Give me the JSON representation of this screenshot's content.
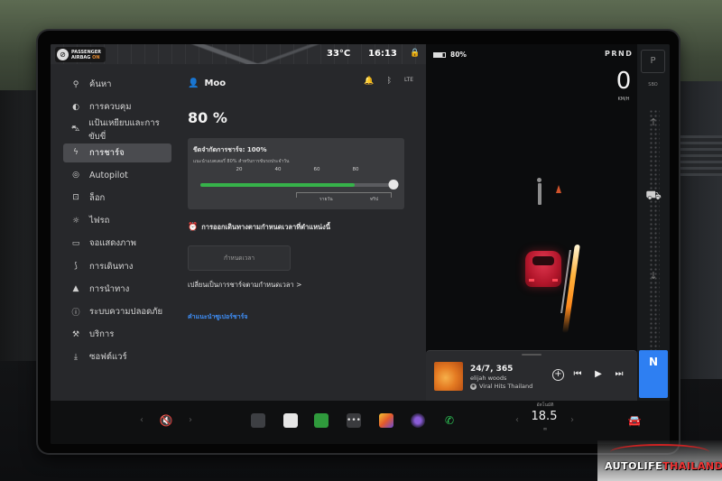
{
  "status_bar": {
    "airbag_line1": "PASSENGER",
    "airbag_line2": "AIRBAG",
    "airbag_state": "ON",
    "temperature": "33°C",
    "time": "16:13"
  },
  "sidebar": {
    "items": [
      {
        "label": "ค้นหา",
        "icon": "search-icon",
        "glyph": "⚲"
      },
      {
        "label": "การควบคุม",
        "icon": "toggle-icon",
        "glyph": "◐"
      },
      {
        "label": "แป้นเหยียบและการขับขี่",
        "icon": "car-icon",
        "glyph": "⛍"
      },
      {
        "label": "การชาร์จ",
        "icon": "lightning-icon",
        "glyph": "ϟ",
        "active": true
      },
      {
        "label": "Autopilot",
        "icon": "steering-wheel-icon",
        "glyph": "◎"
      },
      {
        "label": "ล็อก",
        "icon": "lock-icon",
        "glyph": "⊡"
      },
      {
        "label": "ไฟรถ",
        "icon": "light-icon",
        "glyph": "☼"
      },
      {
        "label": "จอแสดงภาพ",
        "icon": "display-icon",
        "glyph": "▭"
      },
      {
        "label": "การเดินทาง",
        "icon": "trips-icon",
        "glyph": "⟆"
      },
      {
        "label": "การนำทาง",
        "icon": "navigation-icon",
        "glyph": "▲"
      },
      {
        "label": "ระบบความปลอดภัย",
        "icon": "safety-icon",
        "glyph": "ⓘ"
      },
      {
        "label": "บริการ",
        "icon": "wrench-icon",
        "glyph": "⚒"
      },
      {
        "label": "ซอฟต์แวร์",
        "icon": "download-icon",
        "glyph": "⤓"
      }
    ]
  },
  "profile": {
    "name": "Moo",
    "network": "LTE"
  },
  "charging": {
    "state_of_charge": "80 %",
    "limit_title": "ขีดจำกัดการชาร์จ: 100%",
    "limit_sub": "แนะนำแบตเตอรี่ 80% สำหรับการขับรถประจำวัน",
    "ticks": [
      "20",
      "40",
      "60",
      "80"
    ],
    "slider_value": 100,
    "battery_fill": 80,
    "label_daily": "รายวัน",
    "label_trip": "ทริป",
    "departure_label": "การออกเดินทางตามกำหนดเวลาที่ตำแหน่งนี้",
    "schedule_button": "กำหนดเวลา",
    "switch_link": "เปลี่ยนเป็นการชาร์จตามกำหนดเวลา >",
    "tips_link": "คำแนะนำซูเปอร์ชาร์จ"
  },
  "drive": {
    "battery": "80%",
    "gears": "PRND",
    "speed": "0",
    "speed_unit": "KM/H"
  },
  "media": {
    "title": "24/7, 365",
    "artist": "elijah woods",
    "source": "Viral Hits Thailand"
  },
  "gear_rail": {
    "park": "P",
    "park_sub": "SBO",
    "neutral": "N"
  },
  "climate": {
    "label": "อัตโนมัติ",
    "temperature": "18.5"
  },
  "watermark": {
    "text_a": "AUTOLIFE",
    "text_b": "THAILAND.TV"
  },
  "colors": {
    "accent_blue": "#2e7ff2",
    "charge_green": "#36b24a",
    "link_blue": "#3e8ef7",
    "car_red": "#c51a30"
  }
}
